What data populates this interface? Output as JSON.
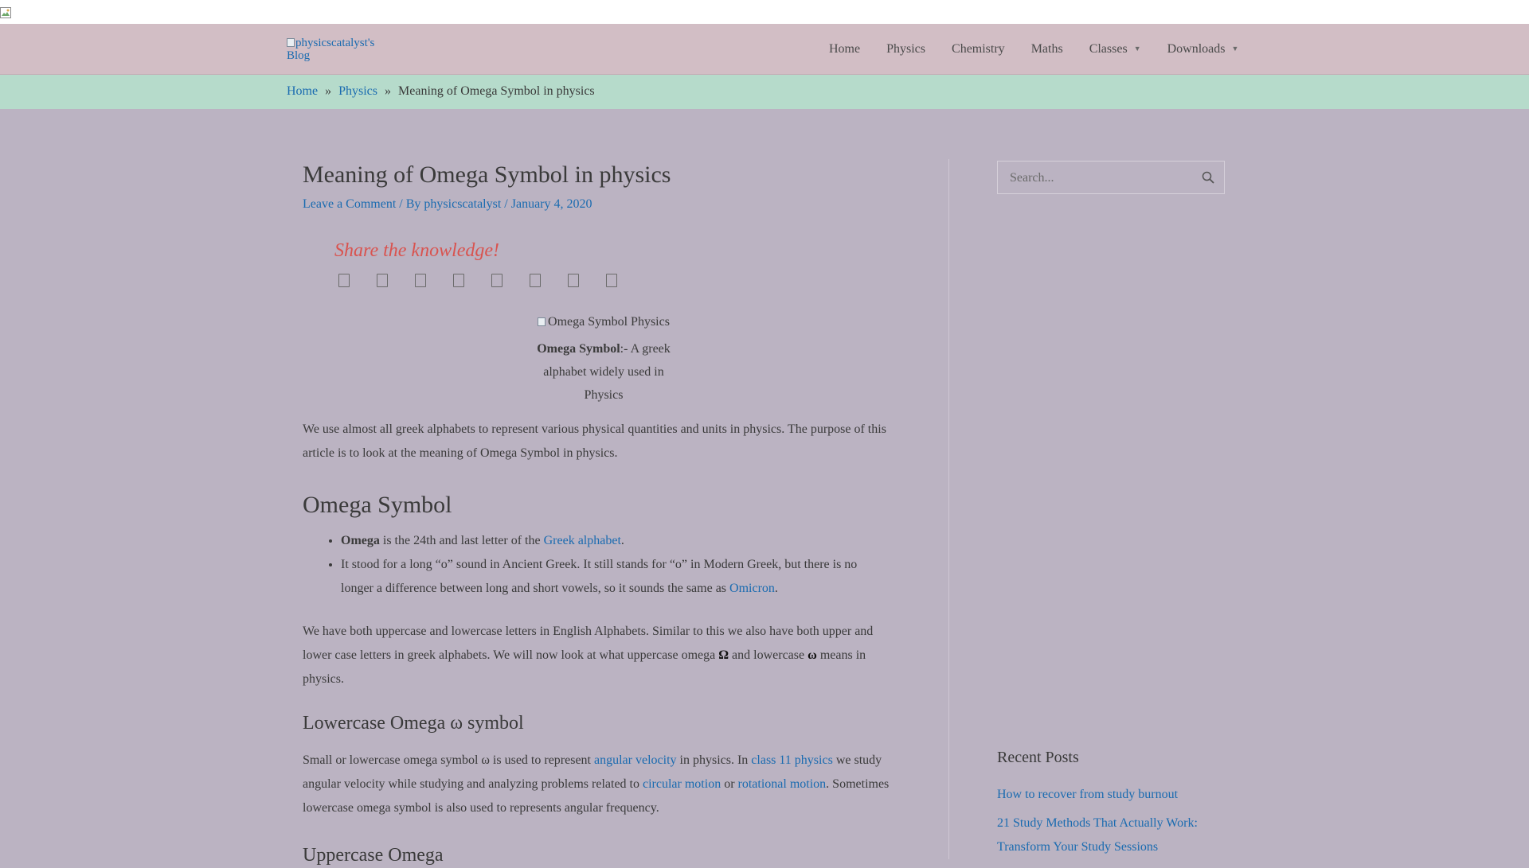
{
  "header": {
    "logo_alt": "physicscatalyst's Blog",
    "nav": [
      {
        "label": "Home"
      },
      {
        "label": "Physics"
      },
      {
        "label": "Chemistry"
      },
      {
        "label": "Maths"
      },
      {
        "label": "Classes"
      },
      {
        "label": "Downloads"
      }
    ]
  },
  "breadcrumb": {
    "home": "Home",
    "sep1": "»",
    "physics": "Physics",
    "sep2": "»",
    "current": "Meaning of Omega Symbol in physics"
  },
  "article": {
    "title": "Meaning of Omega Symbol in physics",
    "meta": {
      "comment": "Leave a Comment",
      "sep1": "/ By",
      "author": "physicscatalyst",
      "sep2": "/",
      "date": "January 4, 2020"
    },
    "share_title": "Share the knowledge!",
    "share_icons": [
      "facebook-icon",
      "twitter-icon",
      "linkedin-icon",
      "pinterest-icon",
      "reddit-icon",
      "whatsapp-icon",
      "email-icon",
      "print-icon"
    ],
    "figure": {
      "alt": "Omega Symbol Physics",
      "caption_bold": "Omega Symbol",
      "caption_rest": ":- A greek alphabet widely used in Physics"
    },
    "intro": "We use almost all greek alphabets to represent various physical quantities and units in physics. The purpose of this article is to look at the meaning of Omega Symbol in physics.",
    "h2_omega": "Omega Symbol",
    "bullet1_bold": "Omega",
    "bullet1_text": " is the 24th and last letter of the ",
    "bullet1_link": "Greek alphabet",
    "bullet1_end": ".",
    "bullet2_text": "It stood for a long “o” sound in Ancient Greek. It still stands for “o” in Modern Greek, but there is no longer a difference between long and short vowels, so it sounds the same as ",
    "bullet2_link": "Omicron",
    "bullet2_end": ".",
    "para2_a": "We have both uppercase and lowercase letters in English Alphabets. Similar to this we also have both upper and lower case letters in greek alphabets. We will now look at what uppercase omega ",
    "para2_upper": "Ω",
    "para2_b": " and lowercase ",
    "para2_lower": "ω",
    "para2_c": " means in physics.",
    "h3_lower": "Lowercase Omega ω symbol",
    "para3_a": "Small or lowercase omega symbol ω is used to represent ",
    "para3_link1": "angular velocity",
    "para3_b": " in physics. In ",
    "para3_link2": "class 11 physics",
    "para3_c": " we study angular velocity while studying and analyzing problems related to ",
    "para3_link3": "circular motion",
    "para3_d": " or ",
    "para3_link4": "rotational motion",
    "para3_e": ". Sometimes lowercase omega symbol is also used to represents angular frequency.",
    "h3_upper": "Uppercase Omega"
  },
  "sidebar": {
    "search_placeholder": "Search...",
    "recent_title": "Recent Posts",
    "recent": [
      "How to recover from study burnout",
      "21 Study Methods That Actually Work: Transform Your Study Sessions"
    ]
  }
}
